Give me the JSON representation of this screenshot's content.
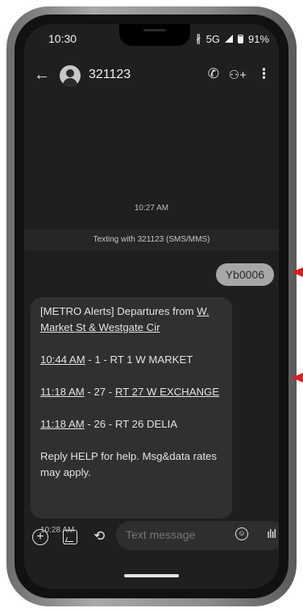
{
  "status": {
    "time": "10:30",
    "network": "5G",
    "battery": "91%",
    "bluetooth_icon": "bluetooth-icon"
  },
  "appbar": {
    "contact": "321123"
  },
  "conversation": {
    "timestamp_top": "10:27 AM",
    "texting_with": "Texting with 321123 (SMS/MMS)",
    "sent_message": "Yb0006",
    "received": {
      "line1_prefix": "[METRO Alerts] Departures from ",
      "line1_link": "W. Market St & Westgate Cir",
      "dep1_time": "10:44 AM",
      "dep1_rest": " - 1 - RT 1 W MARKET",
      "dep2_time": "11:18 AM",
      "dep2_mid": " - 27 - ",
      "dep2_route": "RT 27 W EXCHANGE",
      "dep3_time": "11:18 AM",
      "dep3_rest": " - 26 - RT 26 DELIA",
      "footer": "Reply HELP for help. Msg&data rates may apply."
    },
    "received_time": "10:28 AM"
  },
  "composer": {
    "placeholder": "Text message"
  },
  "colors": {
    "annotation_arrow": "#e11d1d",
    "sent_bubble": "#a7a7a7",
    "received_bubble": "#303030"
  }
}
